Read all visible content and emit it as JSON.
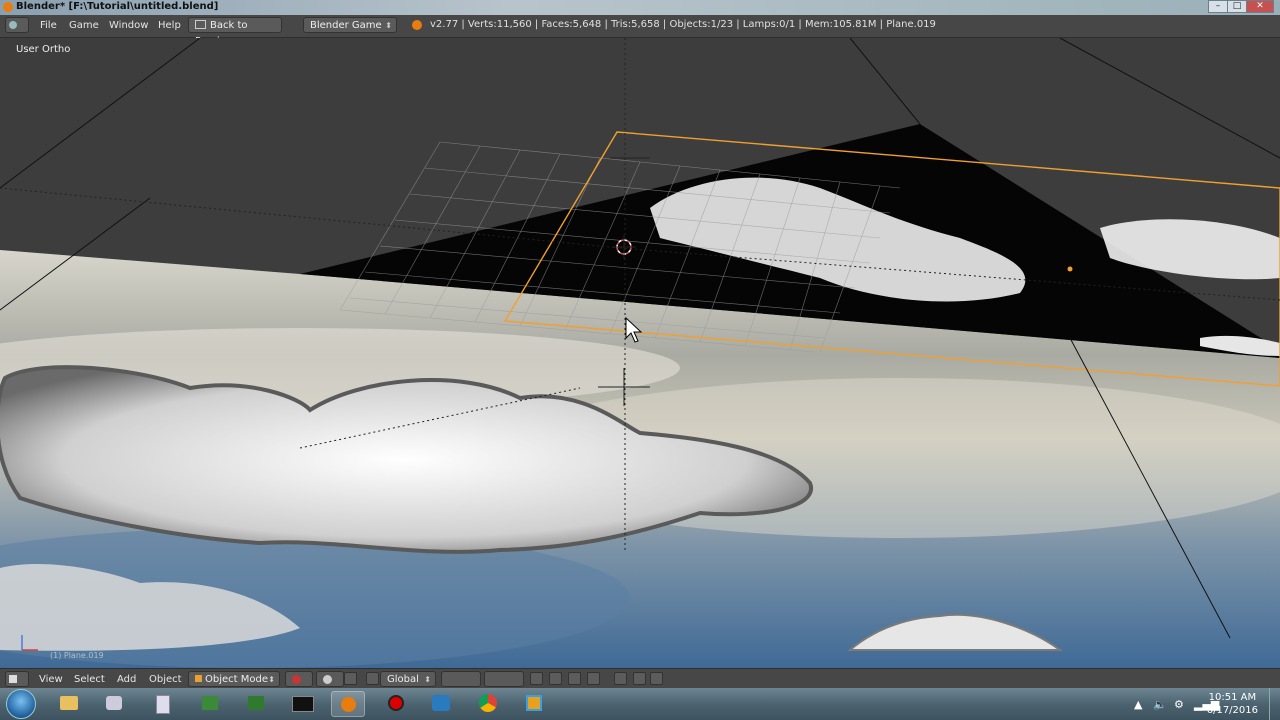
{
  "window": {
    "title": "Blender* [F:\\Tutorial\\untitled.blend]",
    "min": "–",
    "max": "□",
    "close": "✕"
  },
  "header": {
    "menu": [
      "File",
      "Game",
      "Window",
      "Help"
    ],
    "back_button": "Back to Previous",
    "engine": "Blender Game",
    "stats": "v2.77 | Verts:11,560 | Faces:5,648 | Tris:5,658 | Objects:1/23 | Lamps:0/1 | Mem:105.81M | Plane.019"
  },
  "viewport": {
    "view_label": "User Ortho",
    "object_label": "(1) Plane.019"
  },
  "bottom": {
    "menu": [
      "View",
      "Select",
      "Add",
      "Object"
    ],
    "mode": "Object Mode",
    "orientation": "Global"
  },
  "taskbar": {
    "apps": [
      "explorer",
      "camera",
      "calculator",
      "network",
      "network2",
      "terminal",
      "blender",
      "recorder",
      "capture",
      "chrome",
      "file-manager"
    ],
    "time": "10:51 AM",
    "date": "6/17/2016"
  },
  "colors": {
    "selection": "#f0a030",
    "header": "#474747",
    "viewport": "#3d3d3d"
  }
}
